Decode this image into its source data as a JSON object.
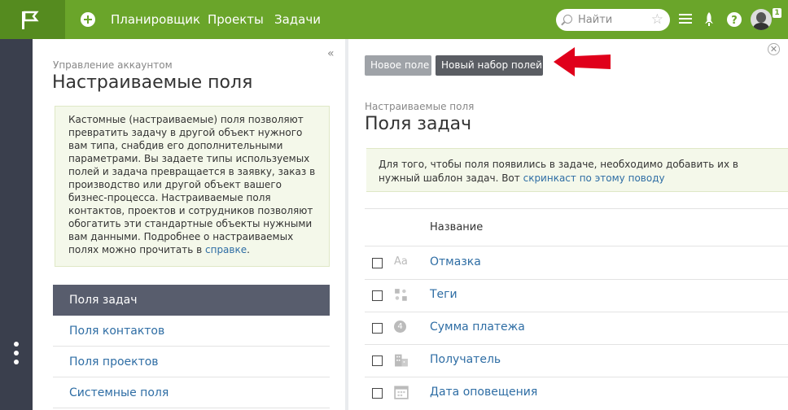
{
  "topbar": {
    "nav": [
      "Планировщик",
      "Проекты",
      "Задачи"
    ],
    "search_placeholder": "Найти",
    "notification_count": "1"
  },
  "left": {
    "breadcrumb": "Управление аккаунтом",
    "title": "Настраиваемые поля",
    "info_text": "Кастомные (настраиваемые) поля позволяют превратить задачу в другой объект нужного вам типа, снабдив его дополнительными параметрами. Вы задаете типы используемых полей и задача превращается в заявку, заказ в производство или другой объект вашего бизнес-процесса. Настраиваемые поля контактов, проектов и сотрудников позволяют обогатить эти стандартные объекты нужными вам данными. Подробнее о настраиваемых полях можно прочитать в ",
    "info_link": "справке",
    "info_tail": ".",
    "menu": [
      "Поля задач",
      "Поля контактов",
      "Поля проектов",
      "Системные поля"
    ]
  },
  "right": {
    "btn_new_field": "Новое поле",
    "btn_new_set": "Новый набор полей",
    "breadcrumb": "Настраиваемые поля",
    "title": "Поля задач",
    "note_text": "Для того, чтобы поля появились в задаче, необходимо добавить их в нужный шаблон задач. Вот ",
    "note_link": "скринкаст по этому поводу",
    "column_name": "Название",
    "rows": [
      {
        "label": "Отмазка",
        "icon": "text-icon",
        "icon_text": "Aa"
      },
      {
        "label": "Теги",
        "icon": "tags-icon",
        "icon_text": ""
      },
      {
        "label": "Сумма платежа",
        "icon": "number-icon",
        "icon_text": "4"
      },
      {
        "label": "Получатель",
        "icon": "building-icon",
        "icon_text": ""
      },
      {
        "label": "Дата оповещения",
        "icon": "calendar-icon",
        "icon_text": ""
      }
    ]
  },
  "colors": {
    "topbar": "#6aa52a",
    "rail": "#3a3f4d",
    "active_menu": "#585d6d",
    "link": "#2e6da4",
    "arrow": "#e0001b"
  }
}
